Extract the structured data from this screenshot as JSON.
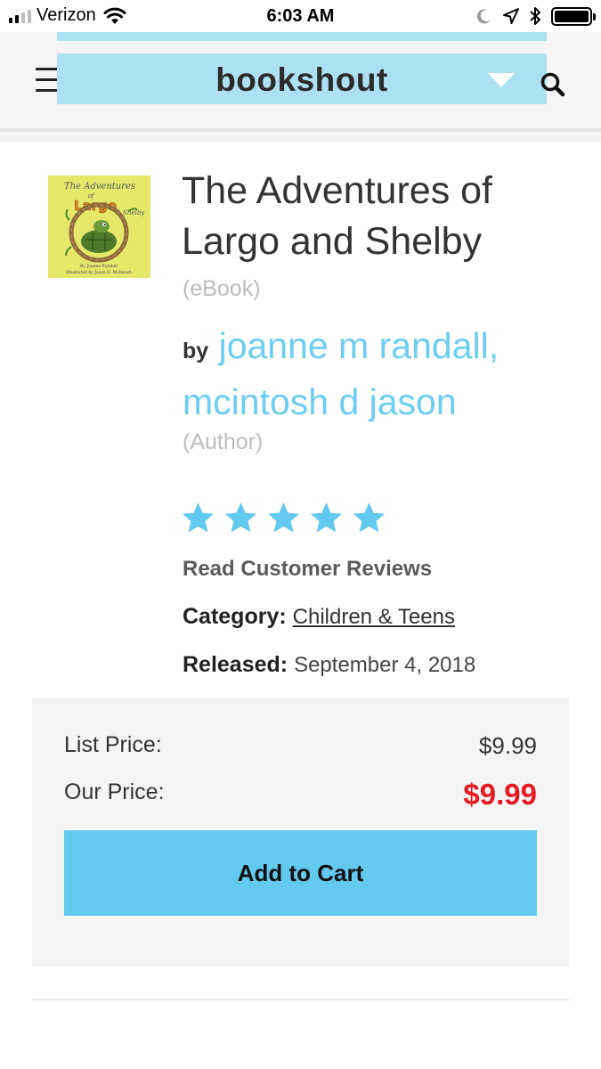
{
  "status_bar": {
    "carrier": "Verizon",
    "time": "6:03 AM",
    "signal_bars": 4,
    "signal_bars_filled": 2
  },
  "header": {
    "logo": "bookshout",
    "banner_color": "#aee0f3",
    "icons": [
      "menu-icon",
      "dropdown-icon",
      "search-icon"
    ]
  },
  "product": {
    "title": "The Adventures of Largo and Shelby",
    "format": "(eBook)",
    "by_label": "by",
    "authors": [
      "joanne m randall,",
      "mcintosh d jason"
    ],
    "role": "(Author)",
    "rating": 5,
    "rating_max": 5,
    "reviews_link": "Read Customer Reviews",
    "category_label": "Category:",
    "category": "Children & Teens",
    "released_label": "Released:",
    "released": "September 4, 2018",
    "cover": {
      "title_line1": "The Adventures",
      "title_line2": "of",
      "name1": "Largo",
      "name2": "& Shelby",
      "author_line": "By Joanne Randall",
      "illustrator_line": "Illustrated by Jason D. McIntosh"
    }
  },
  "pricing": {
    "list_label": "List Price:",
    "list_price": "$9.99",
    "our_label": "Our Price:",
    "our_price": "$9.99",
    "add_to_cart": "Add to Cart"
  },
  "colors": {
    "accent": "#63c9ef",
    "link": "#6ccef0",
    "price_red": "#e31b23",
    "muted": "#bdbdbd"
  }
}
